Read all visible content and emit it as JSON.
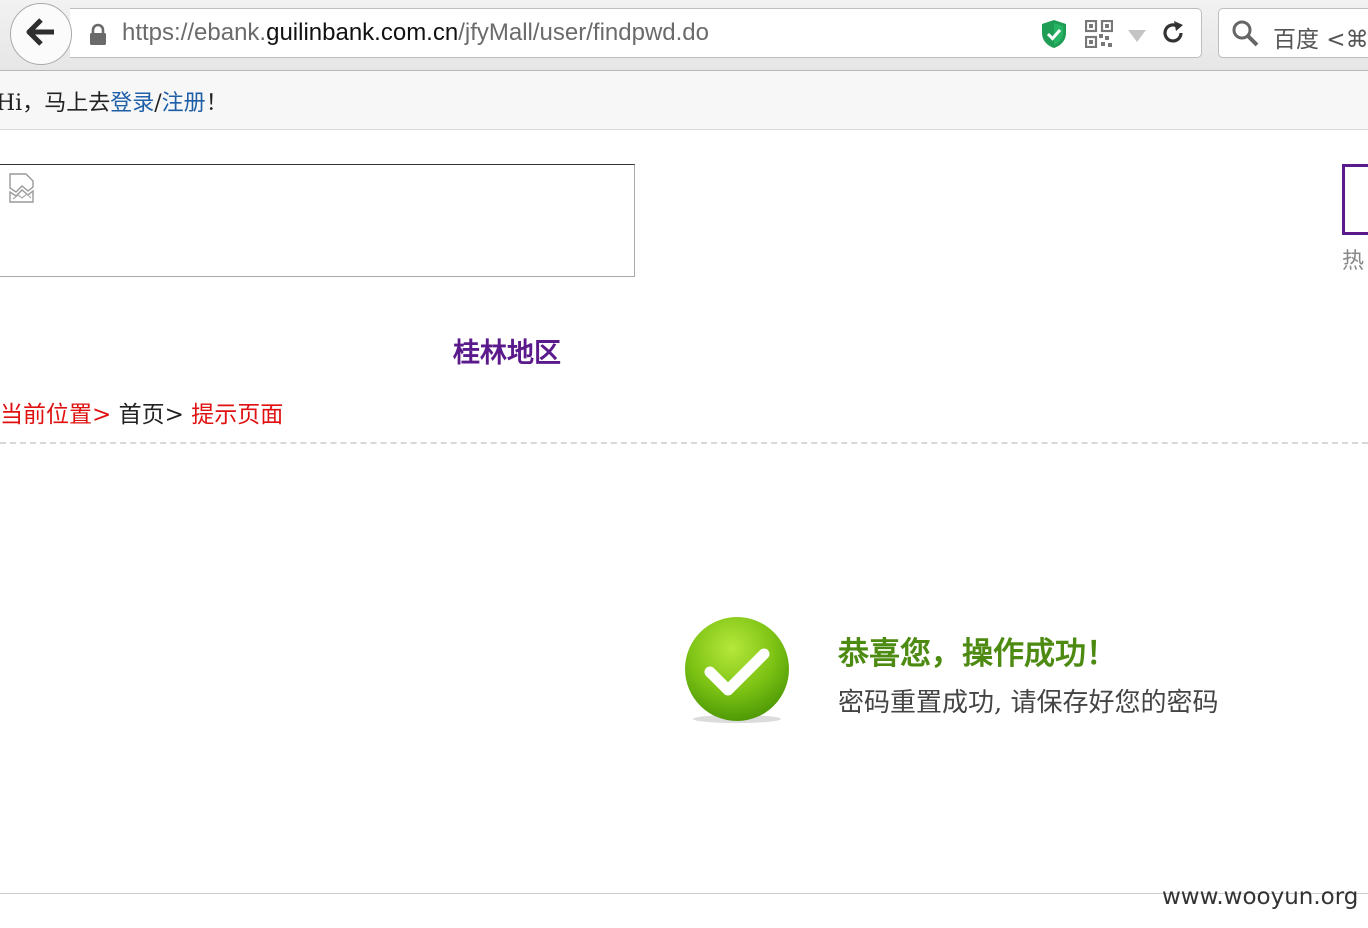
{
  "browser": {
    "url_prefix": "https://ebank.",
    "url_domain": "guilinbank.com.cn",
    "url_path": "/jfyMall/user/findpwd.do",
    "search_placeholder": "百度 <⌘K"
  },
  "header": {
    "greeting_prefix": "Hi，马上去",
    "login_link": "登录",
    "separator": "/",
    "register_link": "注册",
    "greeting_suffix": "！"
  },
  "side": {
    "hot_label": "热"
  },
  "region": {
    "name": "桂林地区"
  },
  "breadcrumb": {
    "current_position": "当前位置>",
    "home": "首页>",
    "page": "提示页面"
  },
  "result": {
    "title": "恭喜您，操作成功！",
    "message": "密码重置成功, 请保存好您的密码"
  },
  "watermark": "www.wooyun.org",
  "colors": {
    "success_green": "#4d8a12",
    "link_blue": "#1f5fa8",
    "breadcrumb_red": "#e01010",
    "region_purple": "#5b1a8c"
  },
  "icons": [
    "back-arrow-icon",
    "lock-icon",
    "shield-check-icon",
    "qr-code-icon",
    "dropdown-arrow-icon",
    "reload-icon",
    "search-icon",
    "broken-image-icon",
    "success-check-icon"
  ]
}
